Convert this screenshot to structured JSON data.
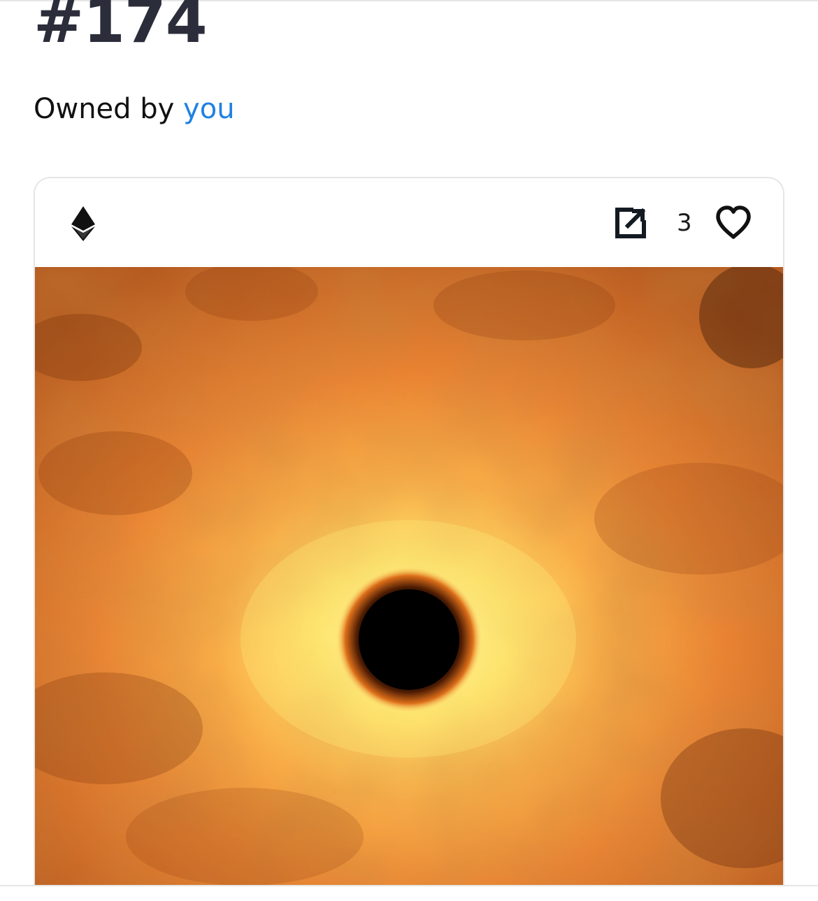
{
  "asset": {
    "title": "#174",
    "owned_by_prefix": "Owned by",
    "owner_name": "you"
  },
  "card": {
    "chain_icon": "ethereum-icon",
    "external_link_icon": "external-link-icon",
    "favorite_icon": "heart-outline-icon",
    "favorites_count": "3"
  },
  "colors": {
    "title": "#2b2d3a",
    "owner_link": "#2081e2",
    "card_border": "#e5e5e5",
    "art_orange": "#cf6d1f",
    "art_glow": "#fff27a",
    "art_core": "#000000"
  }
}
